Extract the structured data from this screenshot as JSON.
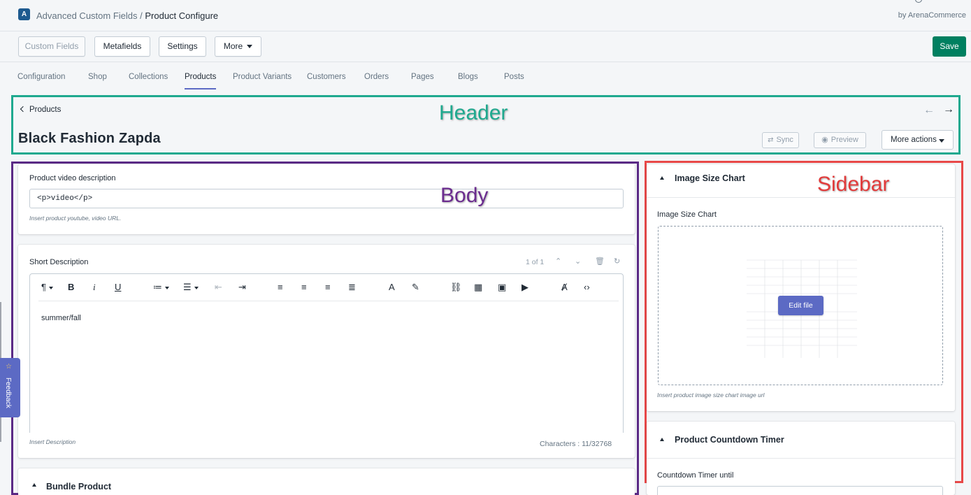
{
  "app": {
    "logo_letter": "A",
    "title_parent": "Advanced Custom Fields",
    "title_separator": " / ",
    "title_current": "Product Configure",
    "by_line": "by ArenaCommerce"
  },
  "toolbar": {
    "custom_fields": "Custom Fields",
    "metafields": "Metafields",
    "settings": "Settings",
    "more": "More",
    "save": "Save"
  },
  "tabs": [
    {
      "label": "Configuration"
    },
    {
      "label": "Shop"
    },
    {
      "label": "Collections"
    },
    {
      "label": "Products",
      "active": true
    },
    {
      "label": "Product Variants"
    },
    {
      "label": "Customers"
    },
    {
      "label": "Orders"
    },
    {
      "label": "Pages"
    },
    {
      "label": "Blogs"
    },
    {
      "label": "Posts"
    }
  ],
  "header": {
    "back_label": "Products",
    "prev_arrow": "←",
    "next_arrow": "→",
    "title": "Black Fashion Zapda",
    "sync_label": "Sync",
    "preview_label": "Preview",
    "more_actions_label": "More actions"
  },
  "annotations": {
    "header": "Header",
    "body": "Body",
    "sidebar": "Sidebar"
  },
  "body": {
    "video": {
      "label": "Product video description",
      "value": "<p>video</p>",
      "help": "Insert product youtube, video URL."
    },
    "short_description": {
      "label": "Short Description",
      "pager": "1 of 1",
      "content": "summer/fall",
      "help": "Insert Description",
      "char_count": "Characters : 11/32768"
    },
    "bundle": {
      "title": "Bundle Product"
    }
  },
  "sidebar": {
    "size_chart": {
      "title": "Image Size Chart",
      "label": "Image Size Chart",
      "edit_file": "Edit file",
      "help": "Insert product image size chart image url"
    },
    "countdown": {
      "title": "Product Countdown Timer",
      "label": "Countdown Timer until"
    }
  },
  "feedback": {
    "label": "Feedback"
  },
  "colors": {
    "primary": "#008060",
    "indigo": "#5c6ac4",
    "header_outline": "#1fa98f",
    "body_outline": "#5b2a86",
    "sidebar_outline": "#e84848"
  }
}
